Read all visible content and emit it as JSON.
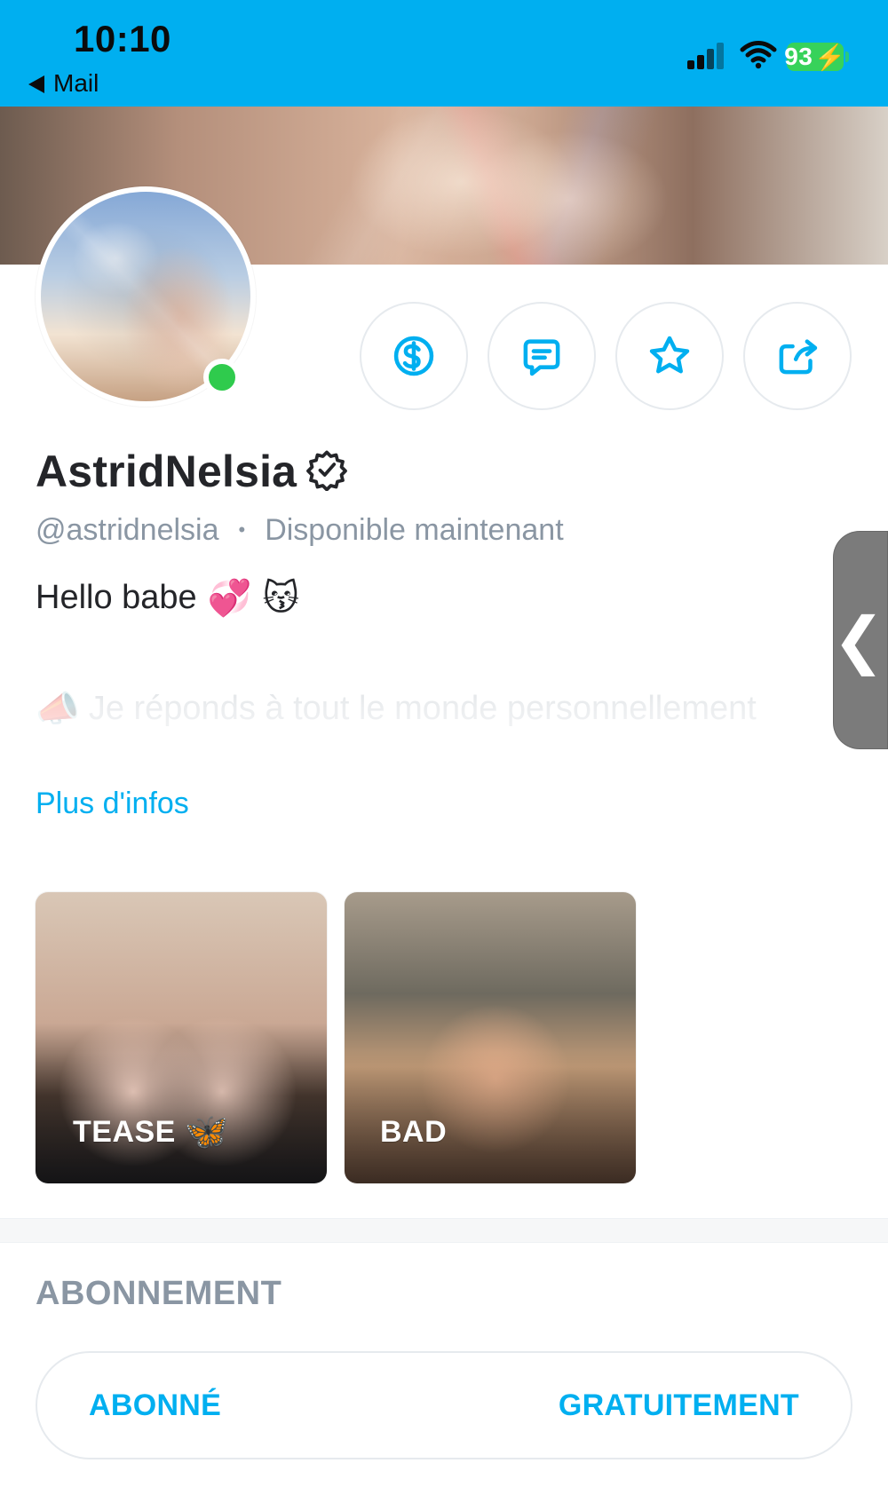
{
  "status_bar": {
    "time": "10:10",
    "back_app": "Mail",
    "battery": "93"
  },
  "profile": {
    "display_name": "AstridNelsia",
    "username": "@astridnelsia",
    "availability": "Disponible maintenant",
    "bio_line1_text": "Hello babe",
    "bio_line1_emoji1": "💞",
    "bio_line1_emoji2": "😽",
    "bio_line2_emoji": "📣",
    "bio_line2_text": "Je réponds à tout le monde personnellement",
    "more_info": "Plus d'infos"
  },
  "actions": [
    {
      "name": "tip",
      "icon": "dollar-coin-icon"
    },
    {
      "name": "message",
      "icon": "message-icon"
    },
    {
      "name": "favorite",
      "icon": "star-icon"
    },
    {
      "name": "share",
      "icon": "share-icon"
    }
  ],
  "highlights": [
    {
      "label": "TEASE",
      "emoji": "🦋"
    },
    {
      "label": "BAD",
      "emoji": ""
    }
  ],
  "subscription": {
    "section_title": "ABONNEMENT",
    "status": "ABONNÉ",
    "price": "GRATUITEMENT"
  },
  "colors": {
    "accent": "#00AFF0",
    "status_bar": "#00AFF0",
    "online": "#2FCB4D",
    "text": "#242529",
    "muted": "#8A96A3"
  }
}
